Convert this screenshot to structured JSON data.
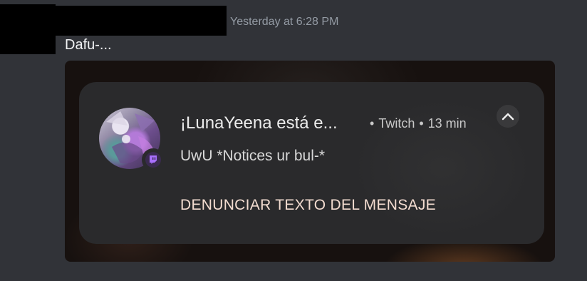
{
  "message": {
    "timestamp": "Yesterday at 6:28 PM",
    "text": "Dafu-..."
  },
  "notification": {
    "title": "¡LunaYeena está e...",
    "source": "Twitch",
    "time": "13 min",
    "body": "UwU *Notices ur bul-*",
    "action": "DENUNCIAR TEXTO DEL MENSAJE",
    "icons": {
      "expand": "chevron-up-icon",
      "app_badge": "twitch-icon"
    },
    "colors": {
      "badge": "#9146ff",
      "action_text": "#f3dcd0"
    }
  }
}
